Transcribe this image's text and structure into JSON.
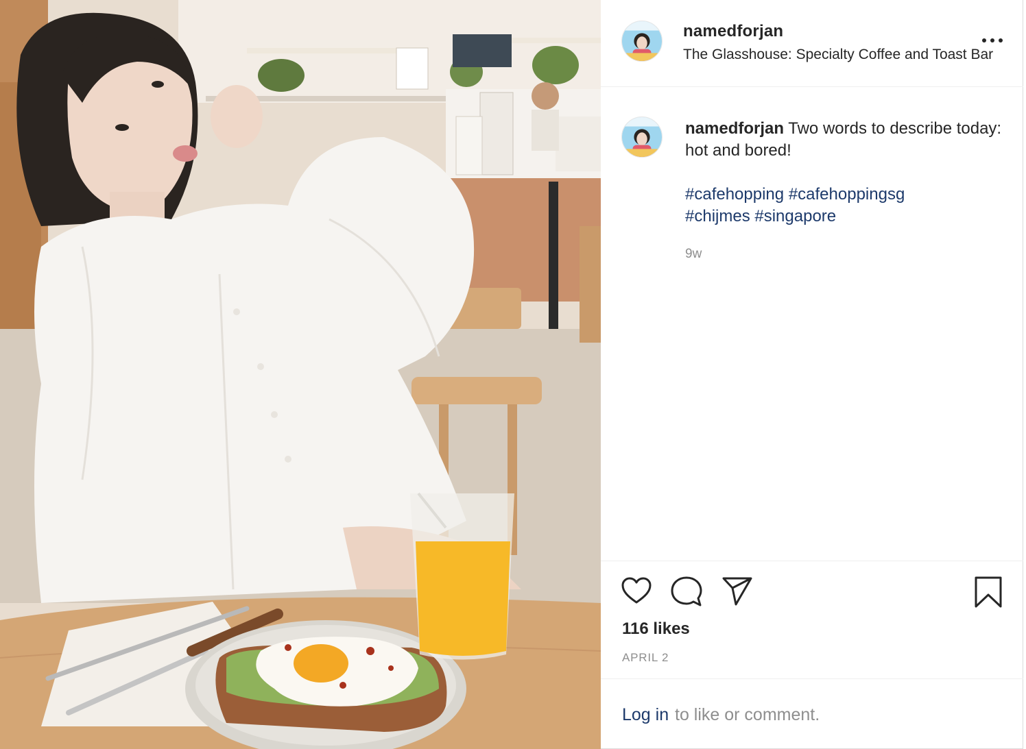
{
  "post": {
    "username": "namedforjan",
    "location": "The Glasshouse: Specialty Coffee and Toast Bar",
    "caption": {
      "username": "namedforjan",
      "text": "Two words to describe today: hot and bored!",
      "hashtags": [
        "#cafehopping",
        "#cafehoppingsg",
        "#chijmes",
        "#singapore"
      ],
      "age": "9w"
    },
    "likes": "116 likes",
    "date": "APRIL 2",
    "login": {
      "link": "Log in",
      "rest": "to like or comment."
    }
  },
  "icons": {
    "more": "more-options-icon",
    "like": "heart-icon",
    "comment": "comment-icon",
    "share": "share-icon",
    "save": "bookmark-icon"
  },
  "colors": {
    "text": "#262626",
    "secondary": "#8e8e8e",
    "link": "#1d3a6b",
    "border": "#dbdbdb"
  }
}
